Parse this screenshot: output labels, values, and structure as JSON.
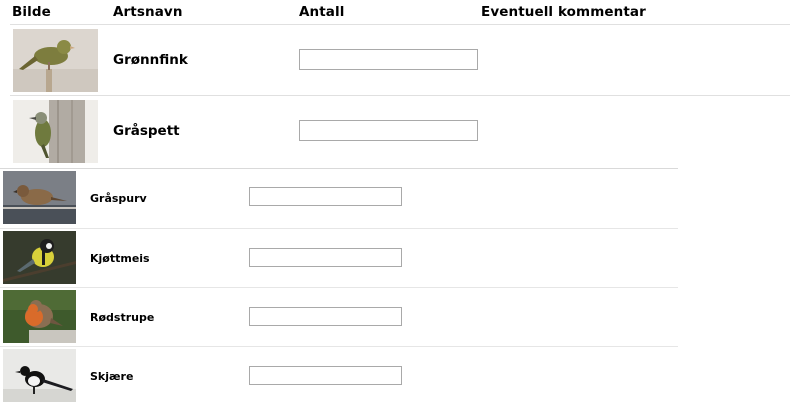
{
  "table": {
    "headers": {
      "image": "Bilde",
      "species": "Artsnavn",
      "count": "Antall",
      "comment": "Eventuell kommentar"
    }
  },
  "birds": [
    {
      "name": "Grønnfink",
      "count_value": "",
      "image_icon": "greenfinch-photo"
    },
    {
      "name": "Gråspett",
      "count_value": "",
      "image_icon": "grey-headed-woodpecker-photo"
    },
    {
      "name": "Gråspurv",
      "count_value": "",
      "image_icon": "house-sparrow-photo"
    },
    {
      "name": "Kjøttmeis",
      "count_value": "",
      "image_icon": "great-tit-photo"
    },
    {
      "name": "Rødstrupe",
      "count_value": "",
      "image_icon": "robin-photo"
    },
    {
      "name": "Skjære",
      "count_value": "",
      "image_icon": "magpie-photo"
    }
  ]
}
